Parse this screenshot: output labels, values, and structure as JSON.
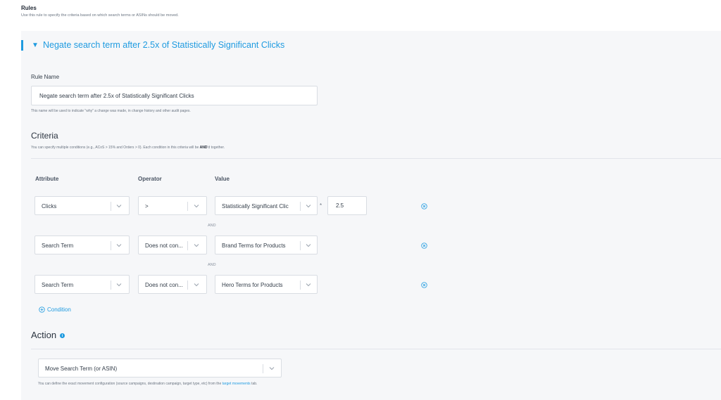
{
  "header": {
    "title": "Rules",
    "subtitle": "Use this rule to specify the criteria based on which search terms or ASINs should be moved."
  },
  "rule": {
    "heading": "Negate search term after 2.5x of Statistically Significant Clicks",
    "name_label": "Rule Name",
    "name_value": "Negate search term after 2.5x of Statistically Significant Clicks",
    "name_hint": "This name will be used to indicate \"why\" a change was made, in change history and other audit pages."
  },
  "criteria": {
    "title": "Criteria",
    "hint_pre": "You can specify multiple conditions (e.g., ACoS > 15% and Orders > 0). Each condition in this criteria will be ",
    "hint_bold": "AND",
    "hint_post": "'d together.",
    "columns": {
      "attribute": "Attribute",
      "operator": "Operator",
      "value": "Value"
    },
    "conditions": [
      {
        "attribute": "Clicks",
        "operator": ">",
        "value": "Statistically Significant Clic",
        "multiplier_sign": "*",
        "multiplier": "2.5"
      },
      {
        "attribute": "Search Term",
        "operator": "Does not con...",
        "value": "Brand Terms for Products"
      },
      {
        "attribute": "Search Term",
        "operator": "Does not con...",
        "value": "Hero Terms for Products"
      }
    ],
    "joiner": "AND",
    "add_condition": "Condition"
  },
  "action": {
    "title": "Action",
    "info_icon": "i",
    "selected": "Move Search Term (or ASIN)",
    "hint_pre": "You can define the exact movement configuration (source campaigns, destination campaign, target type, etc) from the ",
    "hint_link": "target movements",
    "hint_post": " tab."
  },
  "colors": {
    "accent": "#1f9be0",
    "panel": "#f6f7f9",
    "border": "#d9dde3"
  },
  "icons": {
    "collapse": "caret-down-icon",
    "remove": "remove-circle-icon",
    "add": "add-circle-icon",
    "dropdown": "chevron-down-icon",
    "info": "info-icon"
  }
}
